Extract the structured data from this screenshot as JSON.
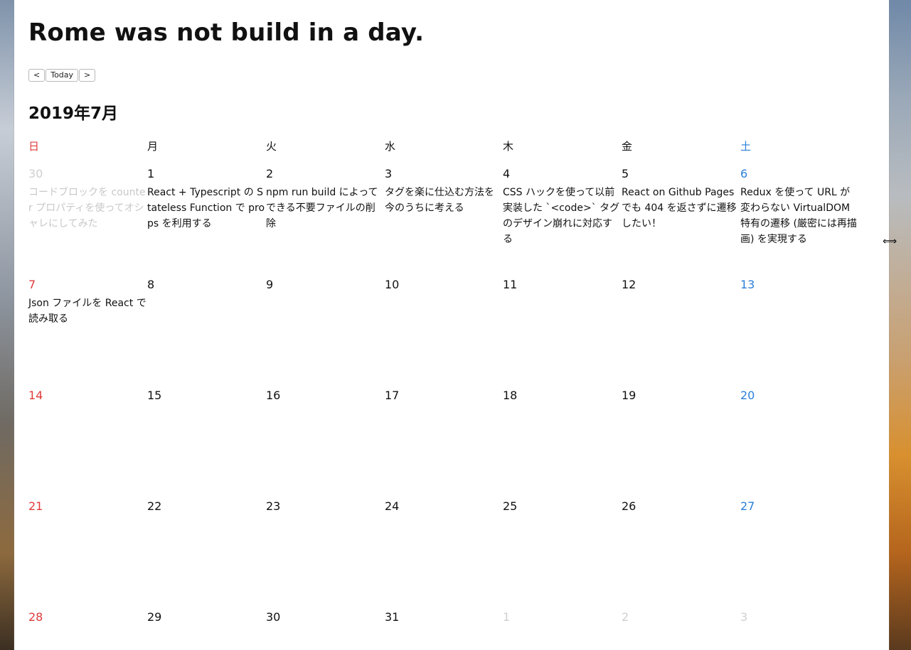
{
  "app": {
    "title": "Rome was not build in a day."
  },
  "nav": {
    "prev_label": "<",
    "today_label": "Today",
    "next_label": ">"
  },
  "calendar": {
    "month_label": "2019年7月",
    "weekdays": [
      "日",
      "月",
      "火",
      "水",
      "木",
      "金",
      "土"
    ],
    "weeks": [
      [
        {
          "day": "30",
          "in_month": false,
          "event": "コードブロックを counter プロパティを使ってオシャレにしてみた"
        },
        {
          "day": "1",
          "in_month": true,
          "event": "React + Typescript の Stateless Function で props を利用する"
        },
        {
          "day": "2",
          "in_month": true,
          "event": "npm run build によってできる不要ファイルの削除"
        },
        {
          "day": "3",
          "in_month": true,
          "event": "タグを楽に仕込む方法を今のうちに考える"
        },
        {
          "day": "4",
          "in_month": true,
          "event": "CSS ハックを使って以前実装した `<code>` タグのデザイン崩れに対応する"
        },
        {
          "day": "5",
          "in_month": true,
          "event": "React on Github Pages でも 404 を返さずに遷移したい！"
        },
        {
          "day": "6",
          "in_month": true,
          "event": "Redux を使って URL が変わらない VirtualDOM 特有の遷移 (厳密には再描画) を実現する"
        }
      ],
      [
        {
          "day": "7",
          "in_month": true,
          "event": "Json ファイルを React で読み取る"
        },
        {
          "day": "8",
          "in_month": true,
          "event": ""
        },
        {
          "day": "9",
          "in_month": true,
          "event": ""
        },
        {
          "day": "10",
          "in_month": true,
          "event": ""
        },
        {
          "day": "11",
          "in_month": true,
          "event": ""
        },
        {
          "day": "12",
          "in_month": true,
          "event": ""
        },
        {
          "day": "13",
          "in_month": true,
          "event": ""
        }
      ],
      [
        {
          "day": "14",
          "in_month": true,
          "event": ""
        },
        {
          "day": "15",
          "in_month": true,
          "event": ""
        },
        {
          "day": "16",
          "in_month": true,
          "event": ""
        },
        {
          "day": "17",
          "in_month": true,
          "event": ""
        },
        {
          "day": "18",
          "in_month": true,
          "event": ""
        },
        {
          "day": "19",
          "in_month": true,
          "event": ""
        },
        {
          "day": "20",
          "in_month": true,
          "event": ""
        }
      ],
      [
        {
          "day": "21",
          "in_month": true,
          "event": ""
        },
        {
          "day": "22",
          "in_month": true,
          "event": ""
        },
        {
          "day": "23",
          "in_month": true,
          "event": ""
        },
        {
          "day": "24",
          "in_month": true,
          "event": ""
        },
        {
          "day": "25",
          "in_month": true,
          "event": ""
        },
        {
          "day": "26",
          "in_month": true,
          "event": ""
        },
        {
          "day": "27",
          "in_month": true,
          "event": ""
        }
      ],
      [
        {
          "day": "28",
          "in_month": true,
          "event": ""
        },
        {
          "day": "29",
          "in_month": true,
          "event": ""
        },
        {
          "day": "30",
          "in_month": true,
          "event": ""
        },
        {
          "day": "31",
          "in_month": true,
          "event": ""
        },
        {
          "day": "1",
          "in_month": false,
          "event": ""
        },
        {
          "day": "2",
          "in_month": false,
          "event": ""
        },
        {
          "day": "3",
          "in_month": false,
          "event": ""
        }
      ]
    ]
  },
  "colors": {
    "sunday": "#e03b3b",
    "saturday": "#2a7fd9",
    "other_month": "#cfcfcf"
  },
  "icons": {
    "cursor": "resize-horizontal-cursor-icon"
  }
}
